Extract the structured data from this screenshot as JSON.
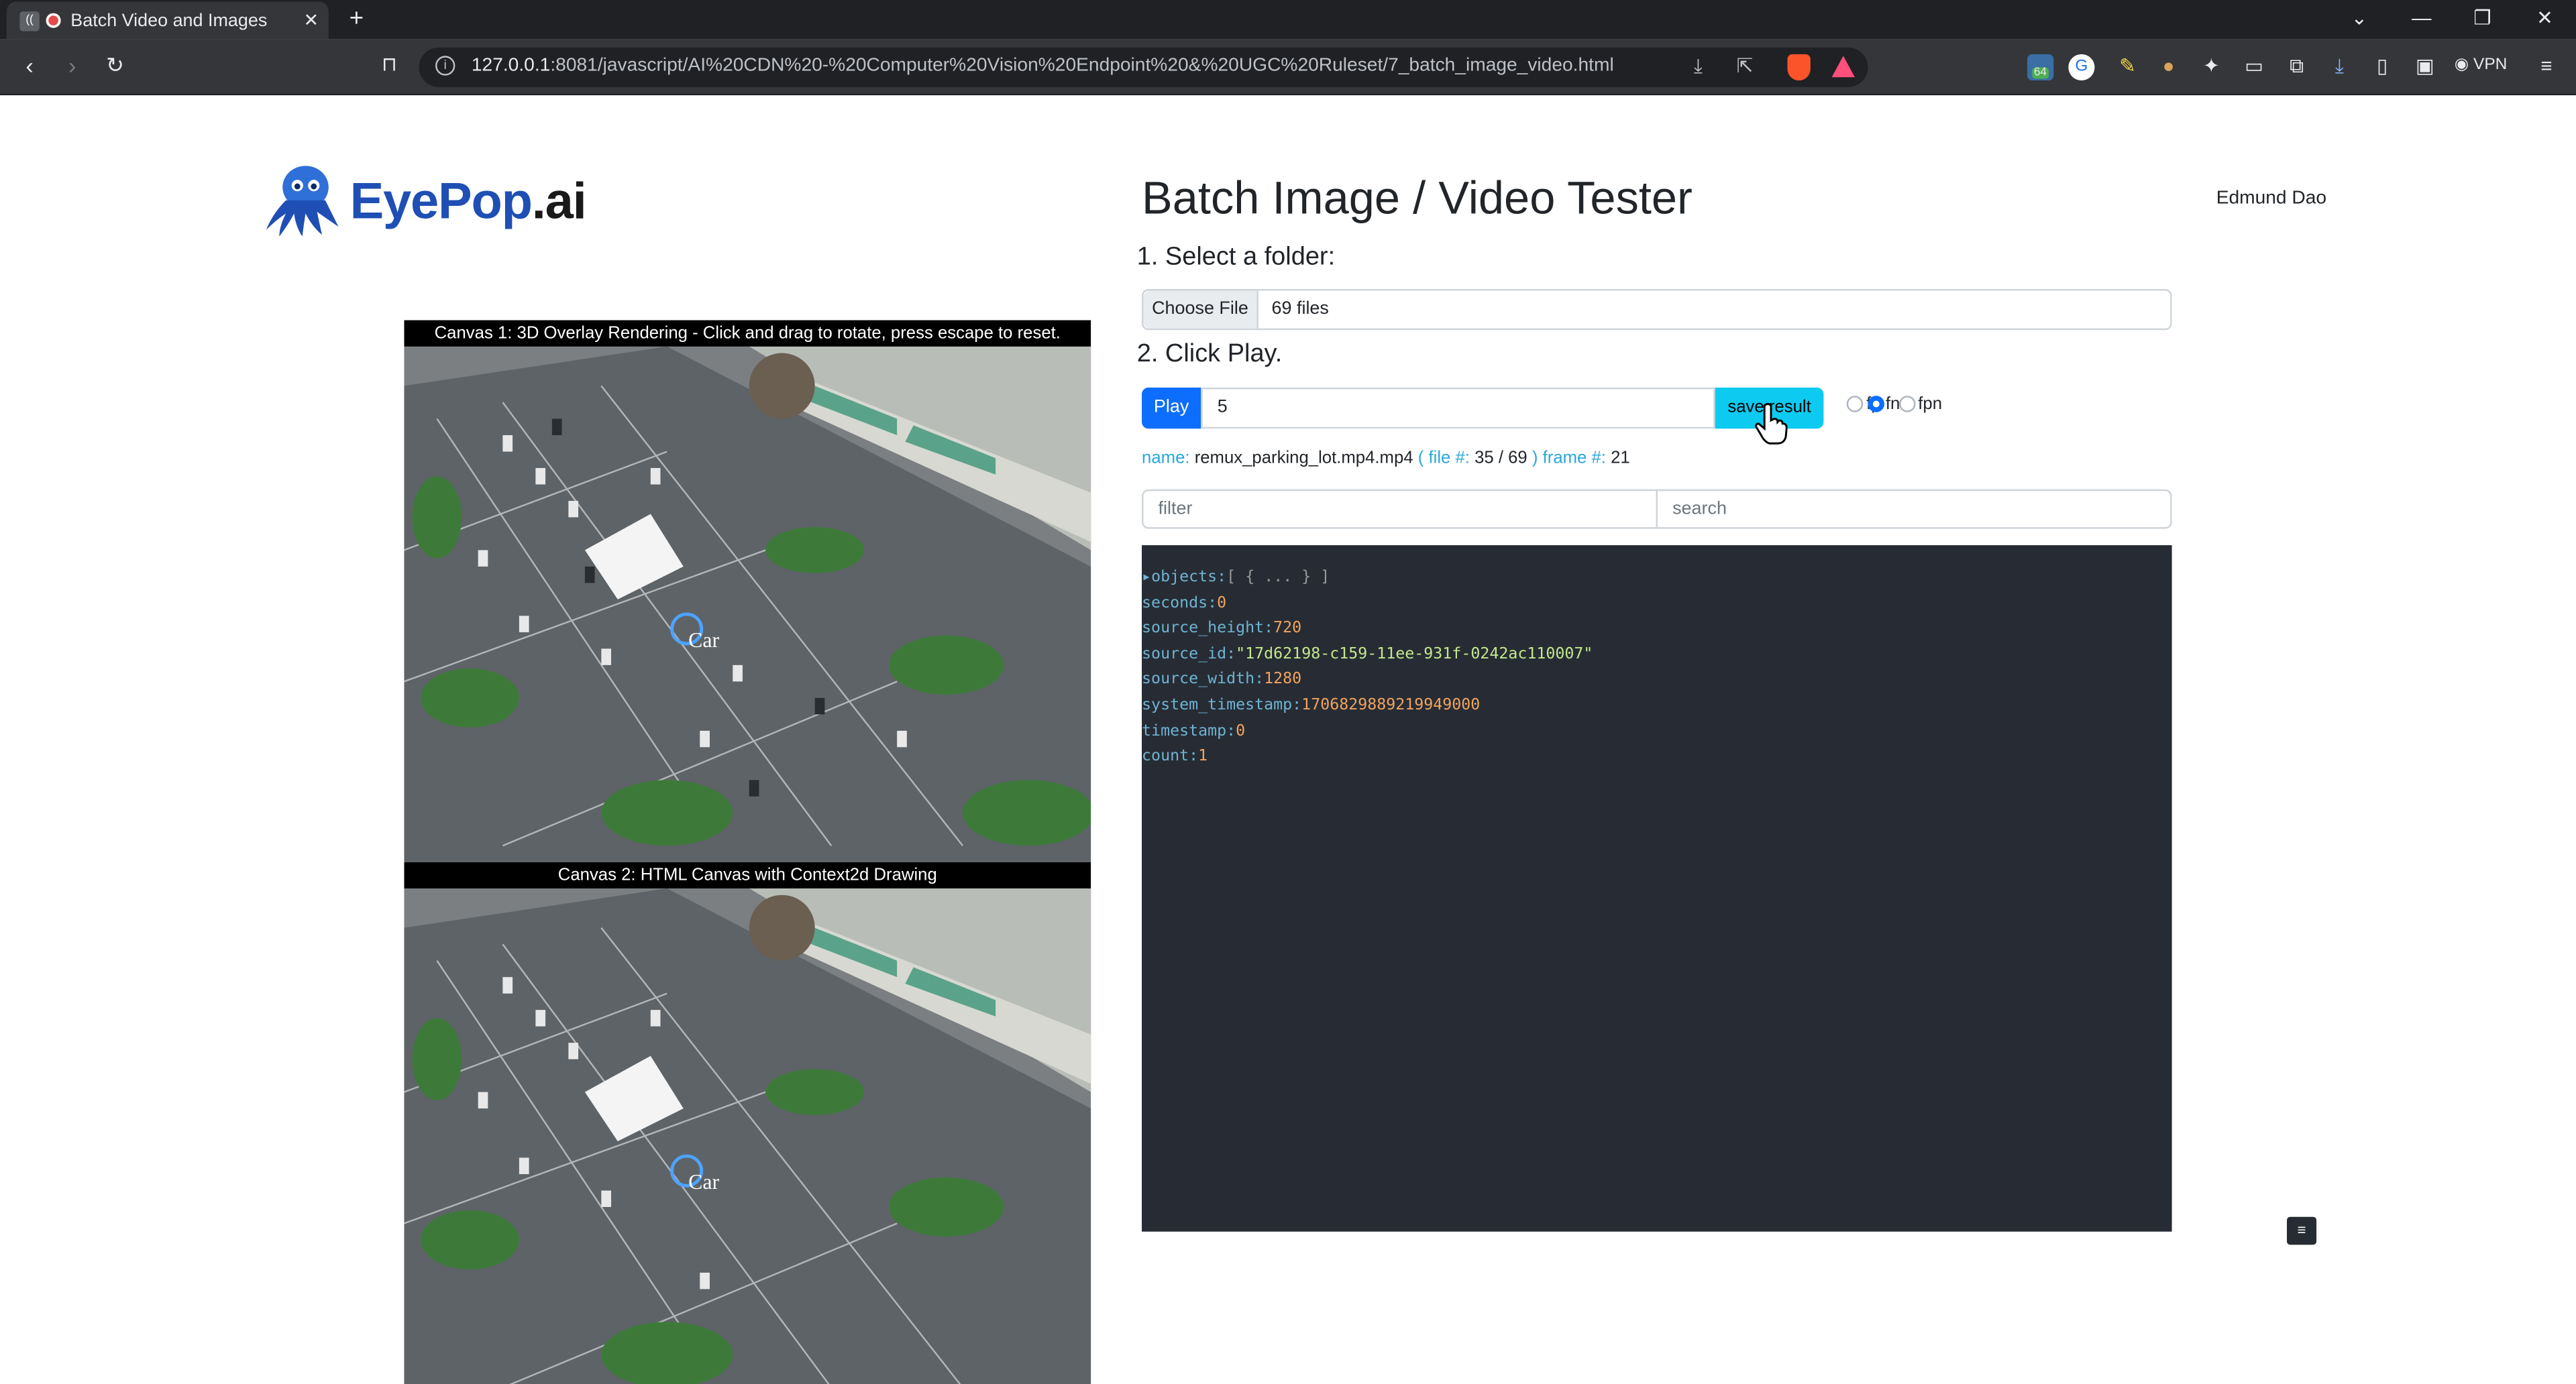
{
  "browser": {
    "tab_title": "Batch Video and Images",
    "url_host": "127.0.0.1",
    "url_rest": ":8081/javascript/AI%20CDN%20-%20Computer%20Vision%20Endpoint%20&%20UGC%20Ruleset/7_batch_image_video.html",
    "extension_badge": "64",
    "vpn_label": "VPN"
  },
  "header": {
    "title": "Batch Image / Video Tester",
    "user_name": "Edmund Dao",
    "logo_text_main": "EyePop",
    "logo_text_suffix": ".ai"
  },
  "steps": {
    "select_folder": "1. Select a folder:",
    "click_play": "2. Click Play."
  },
  "file_input": {
    "button_label": "Choose File",
    "value": "69 files"
  },
  "controls": {
    "play_label": "Play",
    "input_value": "5",
    "save_label": "save result",
    "radio_fp": "fp",
    "radio_fn": "fn",
    "radio_fpn": "fpn",
    "selected": "fn"
  },
  "status": {
    "name_key": "name:",
    "name_value": "remux_parking_lot.mp4.mp4",
    "file_key": "( file #:",
    "file_value": "35 / 69",
    "frame_key": ") frame #:",
    "frame_value": "21"
  },
  "search_fields": {
    "filter_placeholder": "filter",
    "search_placeholder": "search"
  },
  "json_view": {
    "lines": [
      {
        "key": "objects:",
        "value": "[ { ... } ]",
        "kind": "collapsed"
      },
      {
        "key": "seconds:",
        "value": "0",
        "kind": "number"
      },
      {
        "key": "source_height:",
        "value": "720",
        "kind": "number"
      },
      {
        "key": "source_id:",
        "value": "\"17d62198-c159-11ee-931f-0242ac110007\"",
        "kind": "string"
      },
      {
        "key": "source_width:",
        "value": "1280",
        "kind": "number"
      },
      {
        "key": "system_timestamp:",
        "value": "1706829889219949000",
        "kind": "number"
      },
      {
        "key": "timestamp:",
        "value": "0",
        "kind": "number"
      },
      {
        "key": "count:",
        "value": "1",
        "kind": "number"
      }
    ]
  },
  "canvases": {
    "canvas1_caption": "Canvas 1: 3D Overlay Rendering - Click and drag to rotate, press escape to reset.",
    "canvas2_caption": "Canvas 2: HTML Canvas with Context2d Drawing",
    "detection_label": "Car"
  },
  "colors": {
    "primary": "#0d6efd",
    "info": "#0dcaf0",
    "json_bg": "#272c34",
    "logo_blue": "#1f4fb4"
  }
}
